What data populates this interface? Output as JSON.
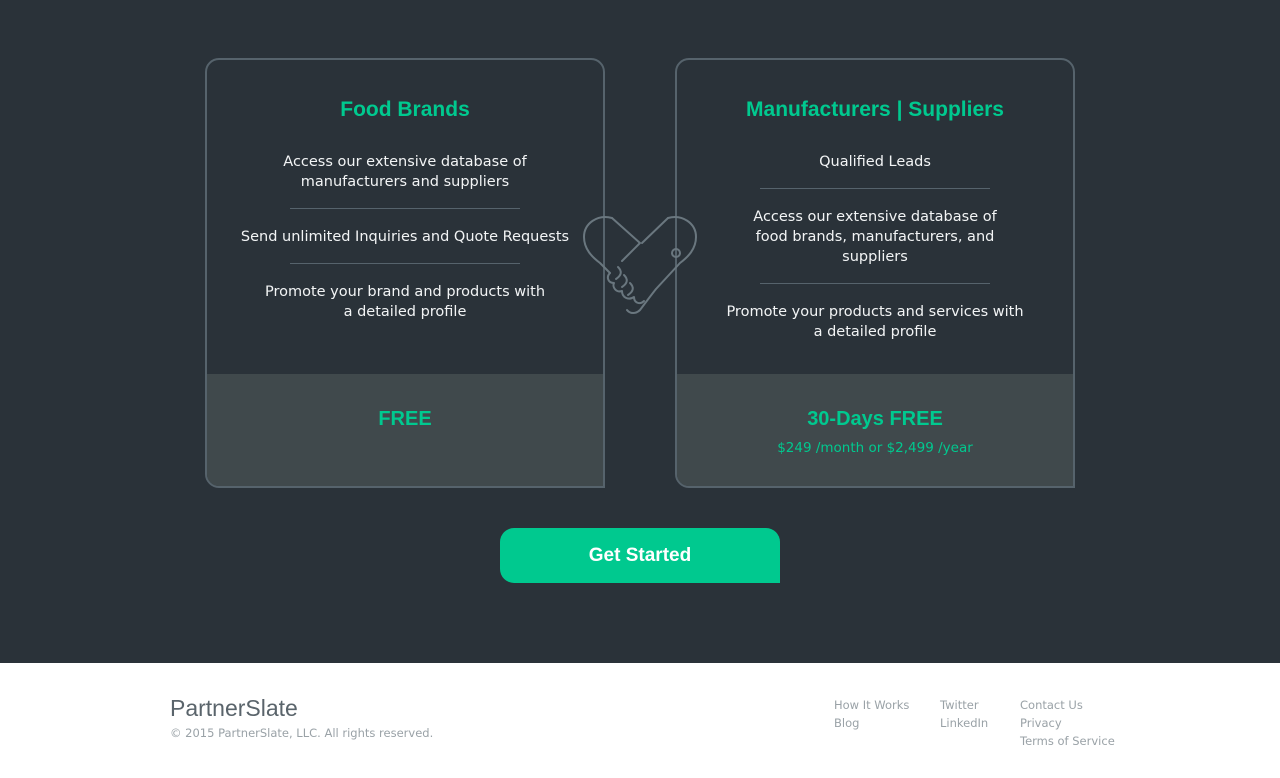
{
  "plans": {
    "food_brands": {
      "title": "Food Brands",
      "features": [
        "Access our extensive database of manufacturers and suppliers",
        "Send unlimited Inquiries and Quote Requests",
        "Promote your brand and products with a detailed profile"
      ],
      "price_title": "FREE",
      "price_sub": ""
    },
    "manufacturers": {
      "title": "Manufacturers | Suppliers",
      "features": [
        "Qualified Leads",
        "Access our extensive database of food brands, manufacturers, and suppliers",
        "Promote your products and services with a detailed profile"
      ],
      "price_title": "30-Days FREE",
      "price_sub": "$249 /month or $2,499 /year"
    }
  },
  "cta": {
    "label": "Get Started"
  },
  "footer": {
    "brand": "PartnerSlate",
    "copyright": "© 2015 PartnerSlate, LLC. All rights reserved.",
    "links": {
      "how_it_works": "How It Works",
      "blog": "Blog",
      "twitter": "Twitter",
      "linkedin": "LinkedIn",
      "contact_us": "Contact Us",
      "privacy": "Privacy",
      "terms": "Terms of Service"
    }
  },
  "colors": {
    "background": "#2a3239",
    "accent": "#00c98f",
    "price_panel": "#40494c",
    "border": "#56636c"
  },
  "icons": {
    "center": "handshake-heart-icon"
  }
}
